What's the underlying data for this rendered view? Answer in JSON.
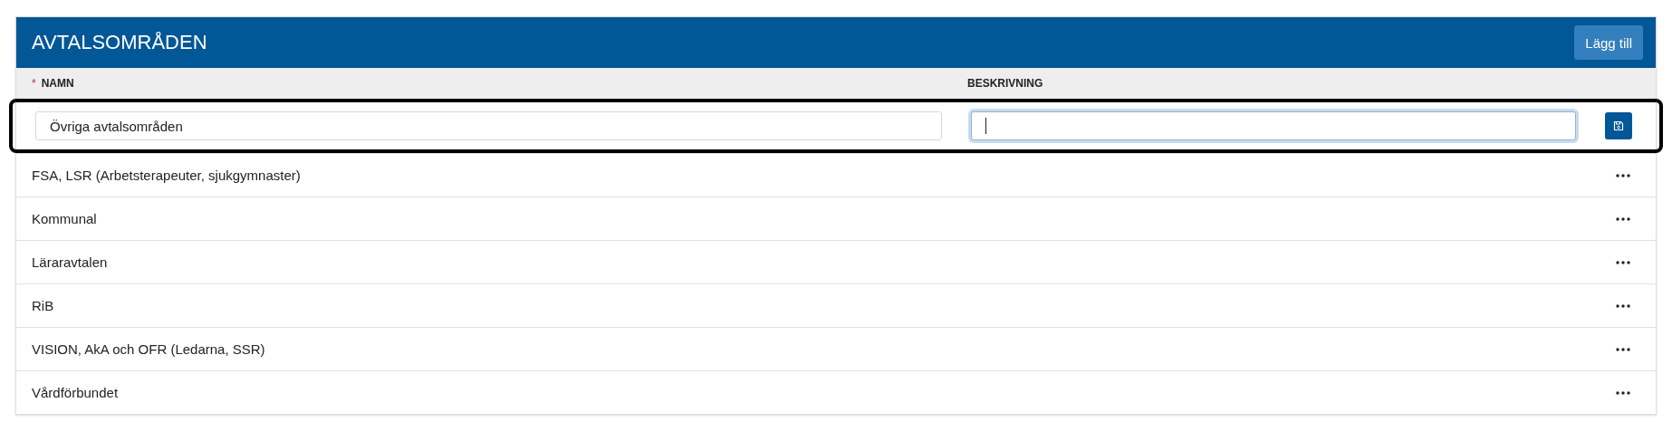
{
  "panel": {
    "title": "AVTALSOMRÅDEN",
    "add_button": "Lägg till"
  },
  "columns": [
    {
      "label": "NAMN",
      "required": true,
      "required_mark": "*"
    },
    {
      "label": "BESKRIVNING",
      "required": false
    }
  ],
  "edit_row": {
    "name_value": "Övriga avtalsområden",
    "description_focused": true,
    "highlighted": true
  },
  "rows": [
    {
      "name": "FSA, LSR (Arbetsterapeuter, sjukgymnaster)"
    },
    {
      "name": "Kommunal"
    },
    {
      "name": "Läraravtalen"
    },
    {
      "name": "RiB"
    },
    {
      "name": "VISION, AkA och OFR (Ledarna, SSR)"
    },
    {
      "name": "Vårdförbundet"
    }
  ]
}
